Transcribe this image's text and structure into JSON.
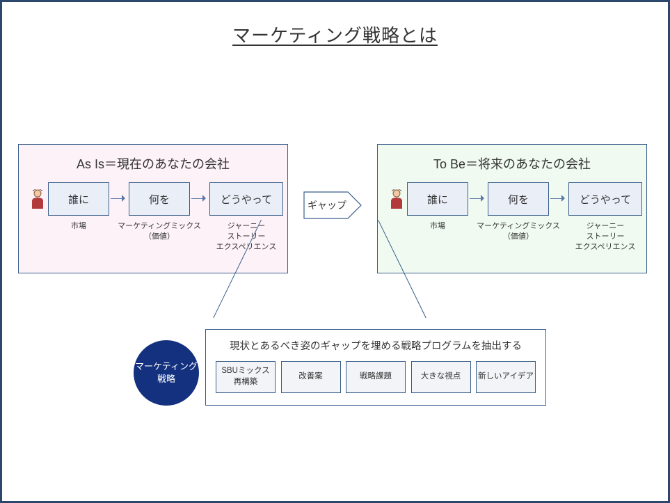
{
  "title": "マーケティング戦略とは",
  "asis": {
    "heading": "As Is＝現在のあなたの会社",
    "steps": {
      "who": {
        "label": "誰に",
        "caption": "市場"
      },
      "what": {
        "label": "何を",
        "caption": "マーケティングミックス\n（価値）"
      },
      "how": {
        "label": "どうやって",
        "caption": "ジャーニー\nストーリー\nエクスペリエンス"
      }
    }
  },
  "tobe": {
    "heading": "To Be＝将来のあなたの会社",
    "steps": {
      "who": {
        "label": "誰に",
        "caption": "市場"
      },
      "what": {
        "label": "何を",
        "caption": "マーケティングミックス\n（価値）"
      },
      "how": {
        "label": "どうやって",
        "caption": "ジャーニー\nストーリー\nエクスペリエンス"
      }
    }
  },
  "gap_label": "ギャップ",
  "circle_label": "マーケティング\n戦略",
  "strategy": {
    "heading": "現状とあるべき姿のギャップを埋める戦略プログラムを抽出する",
    "boxes": [
      "SBUミックス\n再構築",
      "改善案",
      "戦略課題",
      "大きな視点",
      "新しいアイデア"
    ]
  },
  "icon_names": {
    "person": "person-icon",
    "arrow": "arrow-right-icon",
    "gap": "gap-pentagon-icon"
  }
}
